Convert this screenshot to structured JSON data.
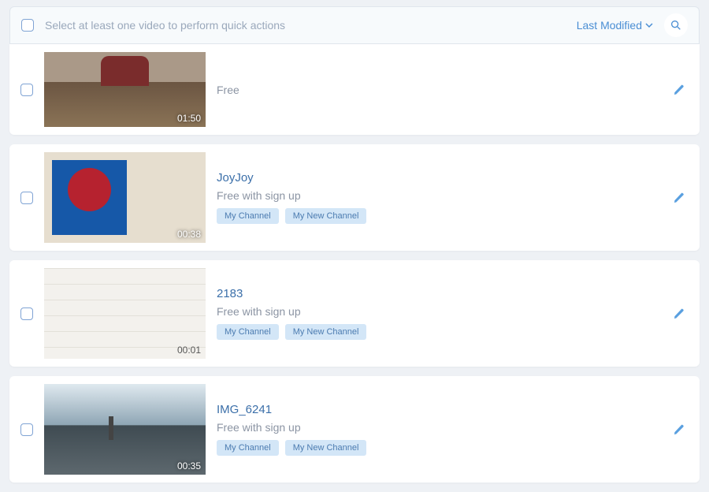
{
  "header": {
    "hint": "Select at least one video to perform quick actions",
    "sort_label": "Last Modified"
  },
  "videos": [
    {
      "title": "",
      "access": "Free",
      "duration": "01:50",
      "channels": []
    },
    {
      "title": "JoyJoy",
      "access": "Free with sign up",
      "duration": "00:38",
      "channels": [
        "My Channel",
        "My New Channel"
      ]
    },
    {
      "title": "2183",
      "access": "Free with sign up",
      "duration": "00:01",
      "channels": [
        "My Channel",
        "My New Channel"
      ]
    },
    {
      "title": "IMG_6241",
      "access": "Free with sign up",
      "duration": "00:35",
      "channels": [
        "My Channel",
        "My New Channel"
      ]
    }
  ]
}
